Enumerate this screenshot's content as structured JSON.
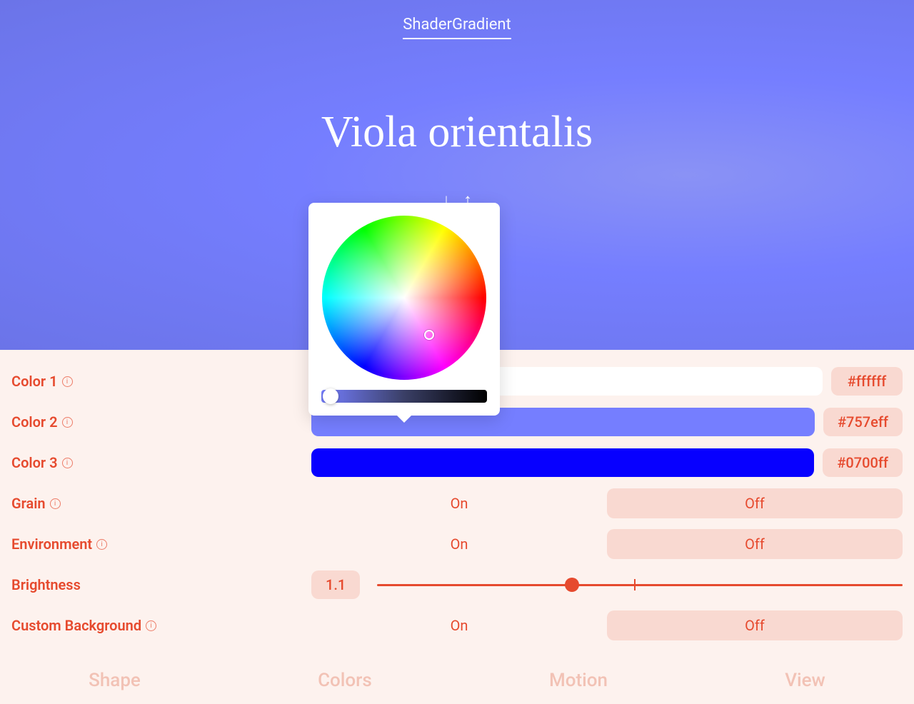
{
  "brand": "ShaderGradient",
  "preset_title": "Viola orientalis",
  "colors": {
    "color1": {
      "label": "Color 1",
      "hex": "#ffffff"
    },
    "color2": {
      "label": "Color 2",
      "hex": "#757eff"
    },
    "color3": {
      "label": "Color 3",
      "hex": "#0700ff"
    }
  },
  "grain": {
    "label": "Grain",
    "on": "On",
    "off": "Off",
    "value": "Off"
  },
  "environment": {
    "label": "Environment",
    "on": "On",
    "off": "Off",
    "value": "Off"
  },
  "brightness": {
    "label": "Brightness",
    "value": "1.1"
  },
  "custom_bg": {
    "label": "Custom Background",
    "on": "On",
    "off": "Off",
    "value": "Off"
  },
  "tabs": {
    "shape": "Shape",
    "colors": "Colors",
    "motion": "Motion",
    "view": "View"
  }
}
